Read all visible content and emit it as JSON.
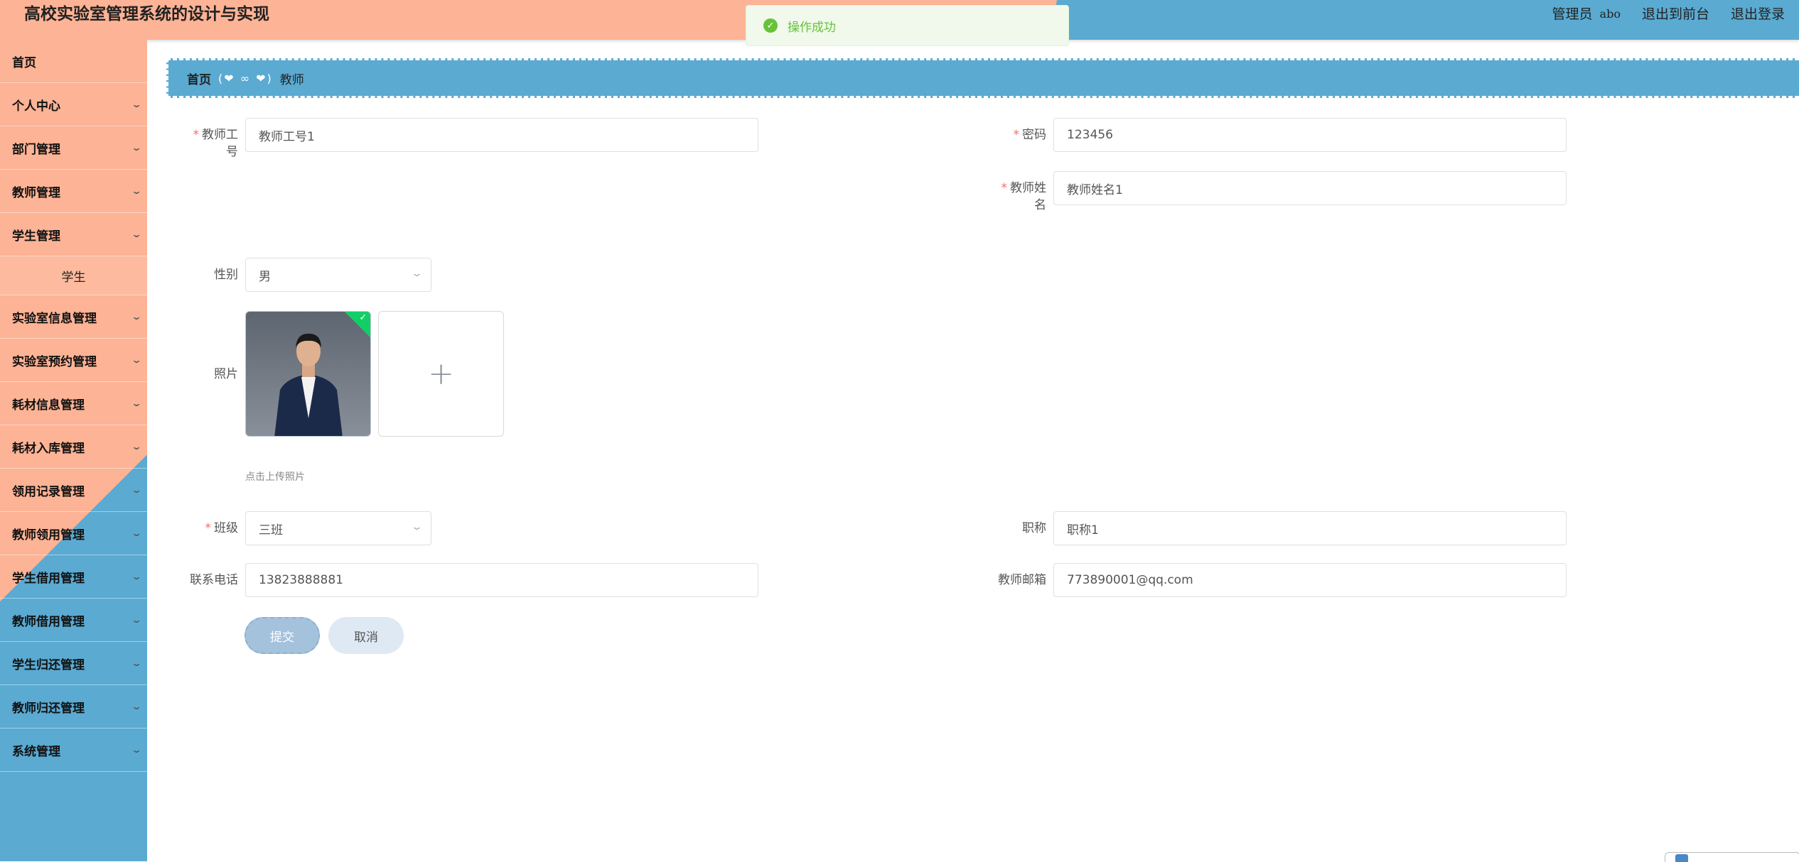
{
  "header": {
    "title": "高校实验室管理系统的设计与实现",
    "role": "管理员",
    "username": "abo",
    "to_frontend": "退出到前台",
    "logout": "退出登录"
  },
  "toast": {
    "message": "操作成功",
    "icon": "check-circle-icon"
  },
  "sidebar": {
    "items": [
      {
        "label": "首页",
        "has_children": false
      },
      {
        "label": "个人中心",
        "has_children": true
      },
      {
        "label": "部门管理",
        "has_children": true
      },
      {
        "label": "教师管理",
        "has_children": true
      },
      {
        "label": "学生管理",
        "has_children": true,
        "expanded": true,
        "children": [
          {
            "label": "学生"
          }
        ]
      },
      {
        "label": "实验室信息管理",
        "has_children": true
      },
      {
        "label": "实验室预约管理",
        "has_children": true
      },
      {
        "label": "耗材信息管理",
        "has_children": true
      },
      {
        "label": "耗材入库管理",
        "has_children": true
      },
      {
        "label": "领用记录管理",
        "has_children": true
      },
      {
        "label": "教师领用管理",
        "has_children": true
      },
      {
        "label": "学生借用管理",
        "has_children": true
      },
      {
        "label": "教师借用管理",
        "has_children": true
      },
      {
        "label": "学生归还管理",
        "has_children": true
      },
      {
        "label": "教师归还管理",
        "has_children": true
      },
      {
        "label": "系统管理",
        "has_children": true
      }
    ]
  },
  "breadcrumb": {
    "home": "首页",
    "separator": "(❤ ∞ ❤)",
    "current": "教师"
  },
  "form": {
    "teacher_no": {
      "label_line1": "教师工",
      "label_line2": "号",
      "value": "教师工号1",
      "required": true
    },
    "password": {
      "label": "密码",
      "value": "123456",
      "required": true
    },
    "teacher_name": {
      "label_line1": "教师姓",
      "label_line2": "名",
      "value": "教师姓名1",
      "required": true
    },
    "gender": {
      "label": "性别",
      "value": "男"
    },
    "photo": {
      "label": "照片",
      "tip": "点击上传照片",
      "add_icon": "plus-icon"
    },
    "class": {
      "label": "班级",
      "value": "三班",
      "required": true
    },
    "title": {
      "label": "职称",
      "value": "职称1"
    },
    "phone": {
      "label": "联系电话",
      "value": "13823888881"
    },
    "email": {
      "label": "教师邮箱",
      "value": "773890001@qq.com"
    },
    "submit": "提交",
    "cancel": "取消"
  },
  "colors": {
    "peach": "#fdb395",
    "blue": "#5aaad2",
    "success": "#67c23a",
    "required": "#f56c6c"
  }
}
